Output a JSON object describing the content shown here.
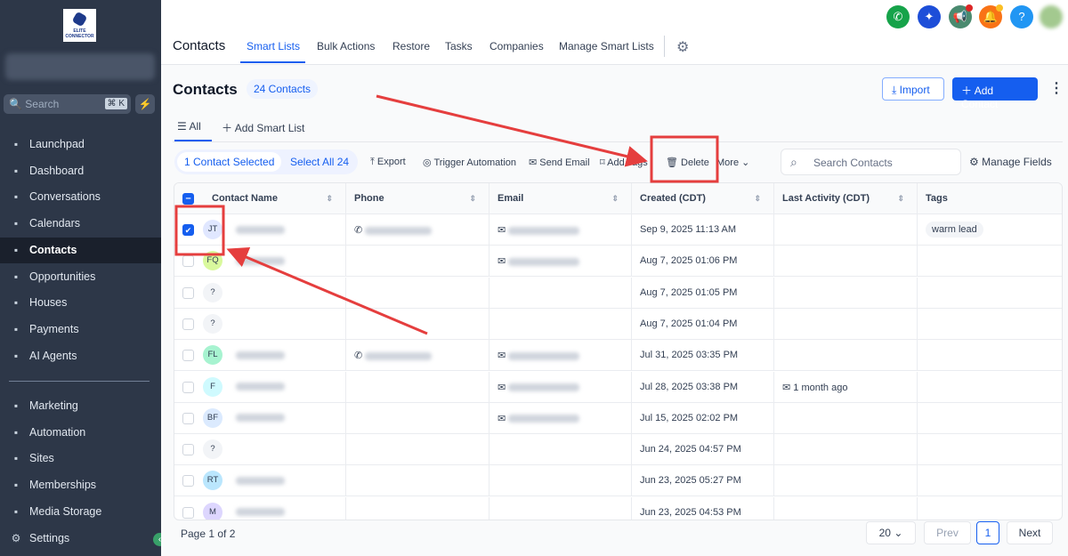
{
  "sidebar": {
    "logo_text": "ELITE CONNECTOR",
    "search_placeholder": "Search",
    "search_shortcut": "⌘ K",
    "items": [
      {
        "label": "Launchpad",
        "icon": "rocket-icon"
      },
      {
        "label": "Dashboard",
        "icon": "grid-icon"
      },
      {
        "label": "Conversations",
        "icon": "chat-icon"
      },
      {
        "label": "Calendars",
        "icon": "calendar-icon"
      },
      {
        "label": "Contacts",
        "icon": "contacts-icon",
        "active": true
      },
      {
        "label": "Opportunities",
        "icon": "opportunities-icon"
      },
      {
        "label": "Houses",
        "icon": "house-icon"
      },
      {
        "label": "Payments",
        "icon": "payments-icon"
      },
      {
        "label": "AI Agents",
        "icon": "ai-icon"
      }
    ],
    "items2": [
      {
        "label": "Marketing",
        "icon": "send-icon"
      },
      {
        "label": "Automation",
        "icon": "automation-icon"
      },
      {
        "label": "Sites",
        "icon": "sites-icon"
      },
      {
        "label": "Memberships",
        "icon": "membership-icon"
      },
      {
        "label": "Media Storage",
        "icon": "media-icon"
      }
    ],
    "settings": "Settings"
  },
  "topbar": {
    "title": "Contacts",
    "tabs": [
      "Smart Lists",
      "Bulk Actions",
      "Restore",
      "Tasks",
      "Companies",
      "Manage Smart Lists"
    ]
  },
  "main": {
    "title": "Contacts",
    "count_badge": "24 Contacts",
    "import": "Import",
    "add_contact": "Add Contact",
    "smart_tabs": {
      "all": "All",
      "add": "Add Smart List"
    },
    "selection": {
      "selected": "1 Contact Selected",
      "select_all": "Select All 24"
    },
    "actions": [
      "Export",
      "Trigger Automation",
      "Send Email",
      "Add Tags",
      "Delete",
      "More"
    ],
    "search_placeholder": "Search Contacts",
    "manage_fields": "Manage Fields",
    "columns": [
      "Contact Name",
      "Phone",
      "Email",
      "Created (CDT)",
      "Last Activity (CDT)",
      "Tags"
    ],
    "rows": [
      {
        "initials": "JT",
        "color": "#e0e7ff",
        "phone": true,
        "email": true,
        "created": "Sep 9, 2025 11:13 AM",
        "activity": "",
        "tag": "warm lead",
        "checked": true
      },
      {
        "initials": "FQ",
        "color": "#d9f99d",
        "phone": false,
        "email": true,
        "created": "Aug 7, 2025 01:06 PM",
        "activity": "",
        "tag": ""
      },
      {
        "initials": "?",
        "color": "#f2f4f7",
        "phone": false,
        "email": false,
        "created": "Aug 7, 2025 01:05 PM",
        "activity": "",
        "tag": ""
      },
      {
        "initials": "?",
        "color": "#f2f4f7",
        "phone": false,
        "email": false,
        "created": "Aug 7, 2025 01:04 PM",
        "activity": "",
        "tag": ""
      },
      {
        "initials": "FL",
        "color": "#a7f3d0",
        "phone": true,
        "email": true,
        "created": "Jul 31, 2025 03:35 PM",
        "activity": "",
        "tag": ""
      },
      {
        "initials": "F",
        "color": "#cffafe",
        "phone": false,
        "email": true,
        "created": "Jul 28, 2025 03:38 PM",
        "activity": "1 month ago",
        "tag": ""
      },
      {
        "initials": "BF",
        "color": "#dbeafe",
        "phone": false,
        "email": true,
        "created": "Jul 15, 2025 02:02 PM",
        "activity": "",
        "tag": ""
      },
      {
        "initials": "?",
        "color": "#f2f4f7",
        "phone": false,
        "email": false,
        "created": "Jun 24, 2025 04:57 PM",
        "activity": "",
        "tag": ""
      },
      {
        "initials": "RT",
        "color": "#bae6fd",
        "phone": false,
        "email": false,
        "created": "Jun 23, 2025 05:27 PM",
        "activity": "",
        "tag": ""
      },
      {
        "initials": "M",
        "color": "#ddd6fe",
        "phone": false,
        "email": false,
        "created": "Jun 23, 2025 04:53 PM",
        "activity": "",
        "tag": ""
      }
    ],
    "pager": {
      "page": "Page 1 of 2",
      "per_page": "20",
      "prev": "Prev",
      "current": "1",
      "next": "Next"
    }
  },
  "colors": {
    "accent": "#155eef",
    "sidebar": "#2d3748",
    "annotation": "#e53e3e"
  }
}
